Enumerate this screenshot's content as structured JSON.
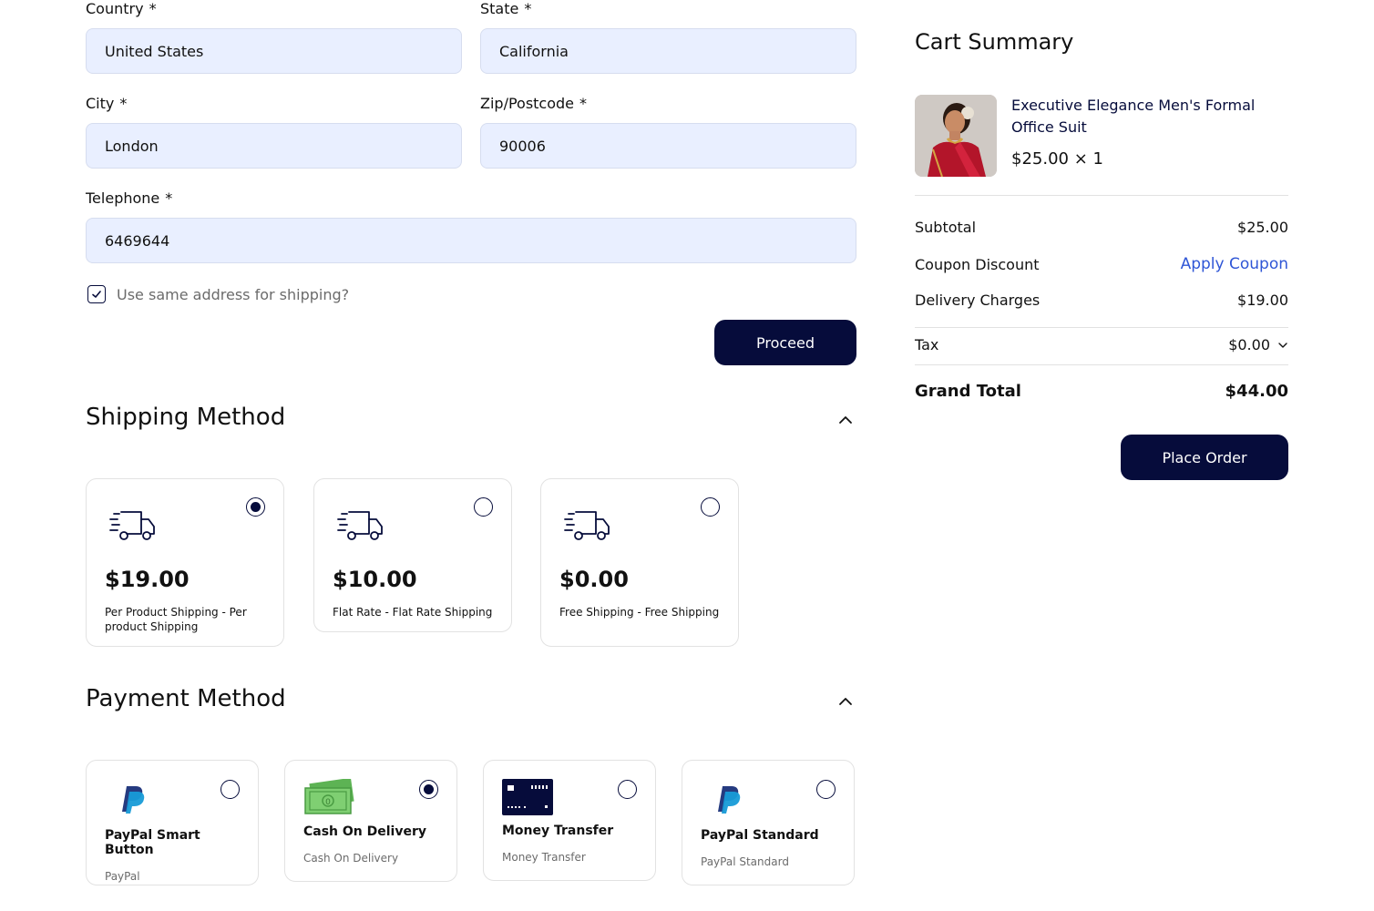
{
  "form": {
    "country": {
      "label": "Country",
      "value": "United States"
    },
    "state": {
      "label": "State",
      "value": "California"
    },
    "city": {
      "label": "City",
      "value": "London"
    },
    "zip": {
      "label": "Zip/Postcode",
      "value": "90006"
    },
    "telephone": {
      "label": "Telephone",
      "value": "6469644"
    },
    "required_mark": "*",
    "same_address_label": "Use same address for shipping?",
    "same_address_checked": true,
    "proceed_label": "Proceed"
  },
  "shipping": {
    "title": "Shipping Method",
    "options": [
      {
        "price": "$19.00",
        "description": "Per Product Shipping - Per product Shipping",
        "selected": true,
        "icon": "truck-icon"
      },
      {
        "price": "$10.00",
        "description": "Flat Rate - Flat Rate Shipping",
        "selected": false,
        "icon": "truck-icon"
      },
      {
        "price": "$0.00",
        "description": "Free Shipping - Free Shipping",
        "selected": false,
        "icon": "truck-icon"
      }
    ]
  },
  "payment": {
    "title": "Payment Method",
    "options": [
      {
        "title": "PayPal Smart Button",
        "subtitle": "PayPal",
        "selected": false,
        "icon": "paypal-icon"
      },
      {
        "title": "Cash On Delivery",
        "subtitle": "Cash On Delivery",
        "selected": true,
        "icon": "cash-icon"
      },
      {
        "title": "Money Transfer",
        "subtitle": "Money Transfer",
        "selected": false,
        "icon": "bank-card-icon"
      },
      {
        "title": "PayPal Standard",
        "subtitle": "PayPal Standard",
        "selected": false,
        "icon": "paypal-icon"
      }
    ]
  },
  "cart": {
    "title": "Cart Summary",
    "item": {
      "name": "Executive Elegance Men's Formal Office Suit",
      "price_qty": "$25.00 × 1"
    },
    "subtotal_label": "Subtotal",
    "subtotal_value": "$25.00",
    "coupon_label": "Coupon Discount",
    "coupon_link": "Apply Coupon",
    "delivery_label": "Delivery Charges",
    "delivery_value": "$19.00",
    "tax_label": "Tax",
    "tax_value": "$0.00",
    "grand_total_label": "Grand Total",
    "grand_total_value": "$44.00",
    "place_order_label": "Place Order"
  },
  "colors": {
    "primary": "#060c3b",
    "input_bg": "#e9efff",
    "link": "#2f56d6",
    "card_border": "#e2e2e2"
  }
}
